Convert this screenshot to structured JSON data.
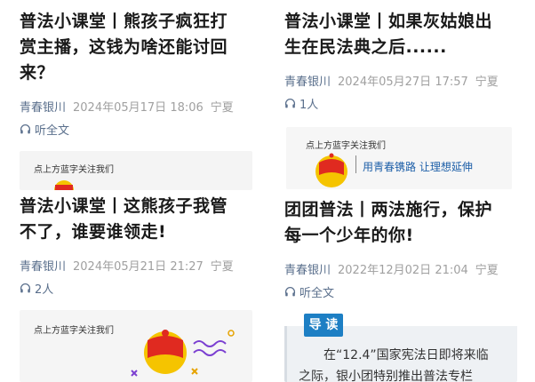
{
  "articles": [
    {
      "title_line1": "普法小课堂丨熊孩子疯狂打",
      "title_line2": "赏主播，这钱为啥还能讨回",
      "title_line3": "来？",
      "author": "青春银川",
      "datetime": "2024年05月17日 18:06",
      "region": "宁夏",
      "listen": "听全文"
    },
    {
      "title_line1": "普法小课堂丨如果灰姑娘出",
      "title_line2": "生在民法典之后......",
      "author": "青春银川",
      "datetime": "2024年05月27日 17:57",
      "region": "宁夏",
      "listen": "1人"
    },
    {
      "title_line1": "普法小课堂丨这熊孩子我管",
      "title_line2": "不了，谁要谁领走!",
      "author": "青春银川",
      "datetime": "2024年05月21日 21:27",
      "region": "宁夏",
      "listen": "2人"
    },
    {
      "title_line1": "团团普法丨两法施行，保护",
      "title_line2": "每一个少年的你!",
      "author": "青春银川",
      "datetime": "2022年12月02日 21:04",
      "region": "宁夏",
      "listen": "听全文"
    }
  ],
  "thumbs": {
    "follow_text": "点上方蓝字关注我们",
    "slogan": "用青春镌路  让理想延伸",
    "guide_label": "导 读",
    "guide_line1": "在“12.4”国家宪法日即将来临",
    "guide_line2": "之际，银小团特别推出普法专栏"
  },
  "colors": {
    "flag_red": "#e02a20",
    "gold": "#f5c400",
    "guide_blue": "#1d7fc4"
  }
}
